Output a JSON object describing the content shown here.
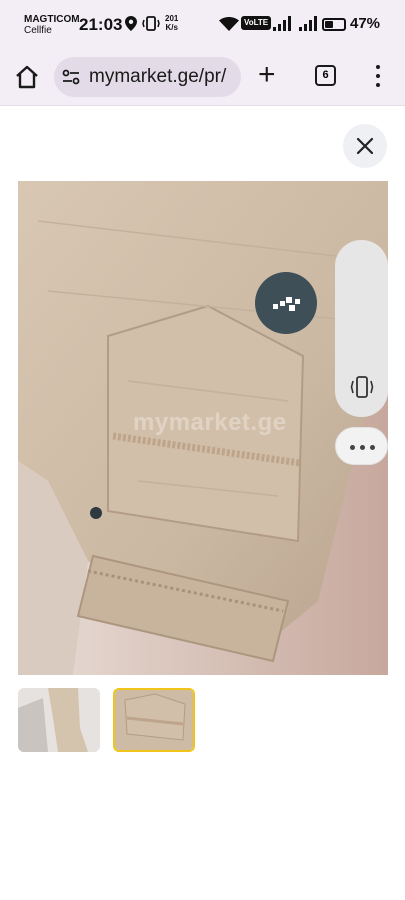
{
  "status_bar": {
    "carrier_line1": "MAGTICOM",
    "carrier_line2": "Cellfie",
    "time": "21:03",
    "speed_value": "201",
    "speed_unit": "K/s",
    "volte_label": "VoLTE",
    "battery_percent": "47%",
    "battery_level": 0.47
  },
  "browser": {
    "url": "mymarket.ge/pr/",
    "tab_count": "6"
  },
  "photo": {
    "watermark": "mymarket.ge"
  },
  "thumbnails": [
    {
      "name": "thumbnail-1",
      "selected": false
    },
    {
      "name": "thumbnail-2",
      "selected": true
    }
  ],
  "colors": {
    "chrome_bg": "#f3eef6",
    "omnibox_bg": "#e3dce8",
    "selected_thumbnail_border": "#f0c419",
    "fabric": "#cdbba6"
  }
}
